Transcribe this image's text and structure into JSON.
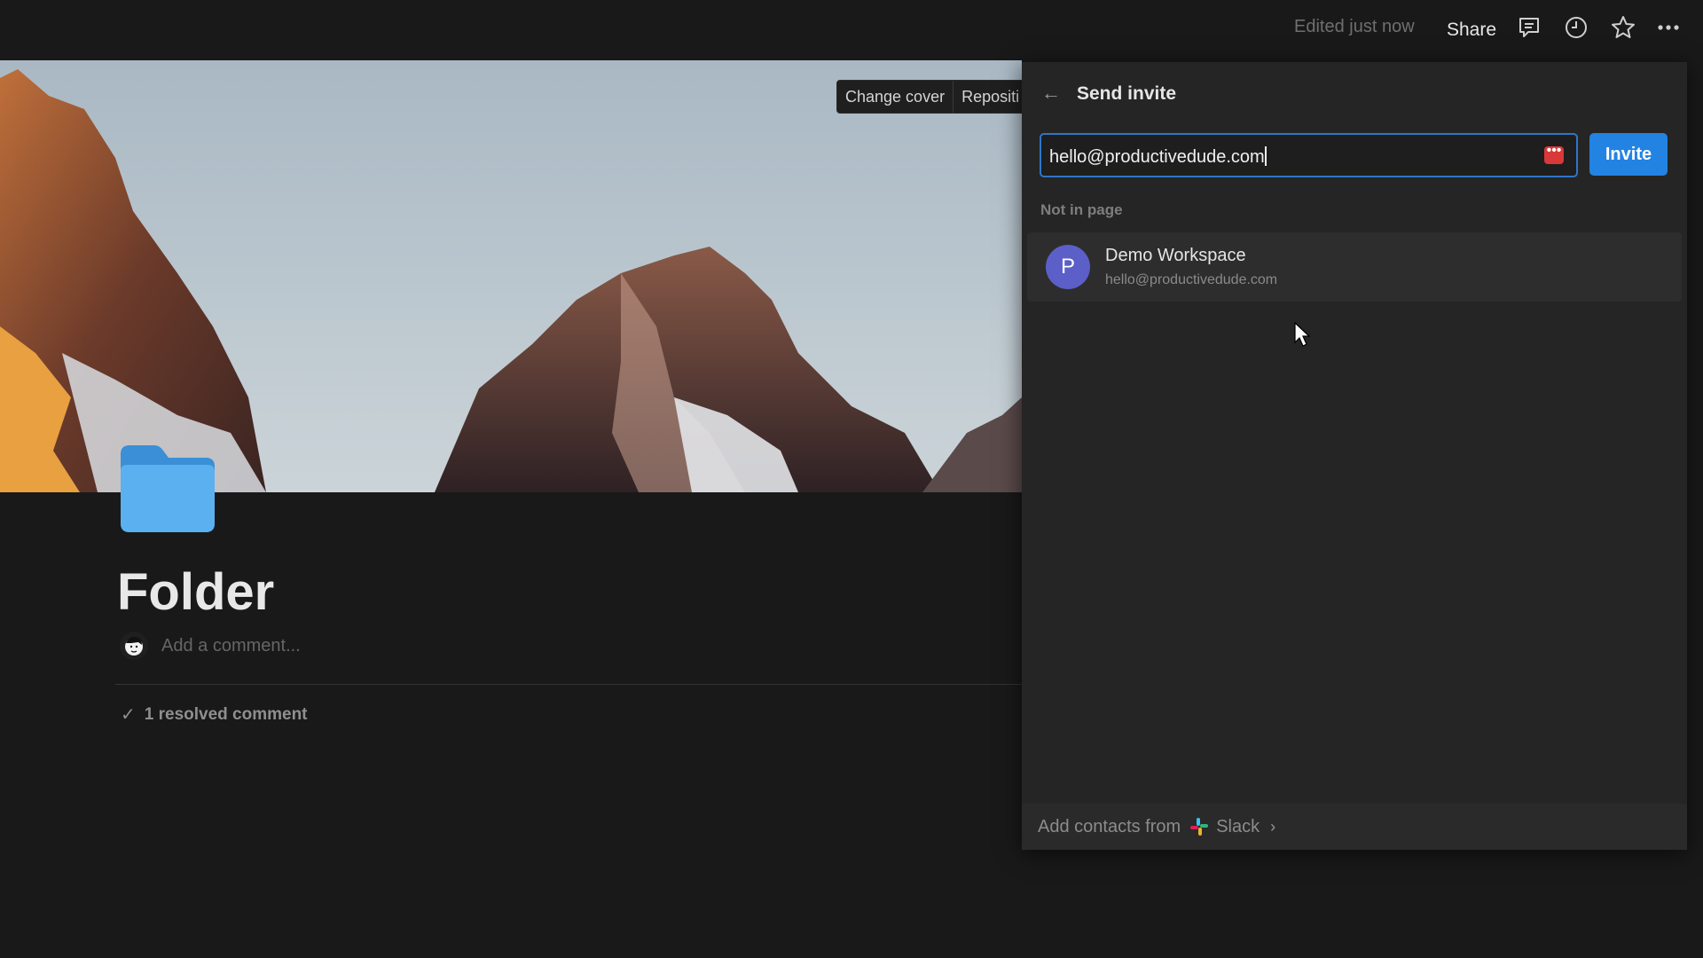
{
  "topbar": {
    "edited": "Edited just now",
    "share_label": "Share",
    "icons": [
      "comment-icon",
      "clock-icon",
      "star-icon",
      "more-icon"
    ]
  },
  "cover": {
    "change_cover": "Change cover",
    "reposition": "Repositi"
  },
  "page": {
    "title": "Folder",
    "icon": "folder-icon",
    "comment_placeholder": "Add a comment...",
    "resolved_check": "✓",
    "resolved_label": "1 resolved comment"
  },
  "invite_panel": {
    "back_icon": "←",
    "title": "Send invite",
    "input_value": "hello@productivedude.com",
    "invite_button": "Invite",
    "section_label": "Not in page",
    "member": {
      "avatar_letter": "P",
      "name": "Demo Workspace",
      "email": "hello@productivedude.com"
    },
    "footer": {
      "label": "Add contacts from",
      "service": "Slack",
      "chevron": "›"
    }
  },
  "colors": {
    "background": "#191919",
    "panel": "#252525",
    "accent": "#2383e2",
    "avatar": "#5b5fc7"
  }
}
